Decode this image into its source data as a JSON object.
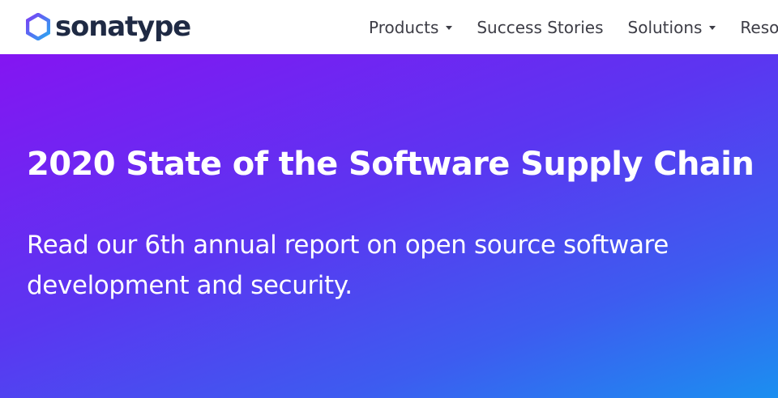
{
  "brand": {
    "name": "sonatype",
    "icon": "hexagon-logo-icon",
    "colors": {
      "hex_outer": "#5b4ff5",
      "hex_inner": "#2aa8f0",
      "text": "#1f2a44"
    }
  },
  "nav": {
    "items": [
      {
        "label": "Products",
        "has_dropdown": true
      },
      {
        "label": "Success Stories",
        "has_dropdown": false
      },
      {
        "label": "Solutions",
        "has_dropdown": true
      },
      {
        "label": "Resources",
        "has_dropdown": true
      }
    ]
  },
  "hero": {
    "title": "2020 State of the Software Supply Chain",
    "subtitle": "Read our 6th annual report on open source software development and security.",
    "gradient": {
      "start": "#8415f2",
      "end": "#1b8ff0"
    }
  }
}
